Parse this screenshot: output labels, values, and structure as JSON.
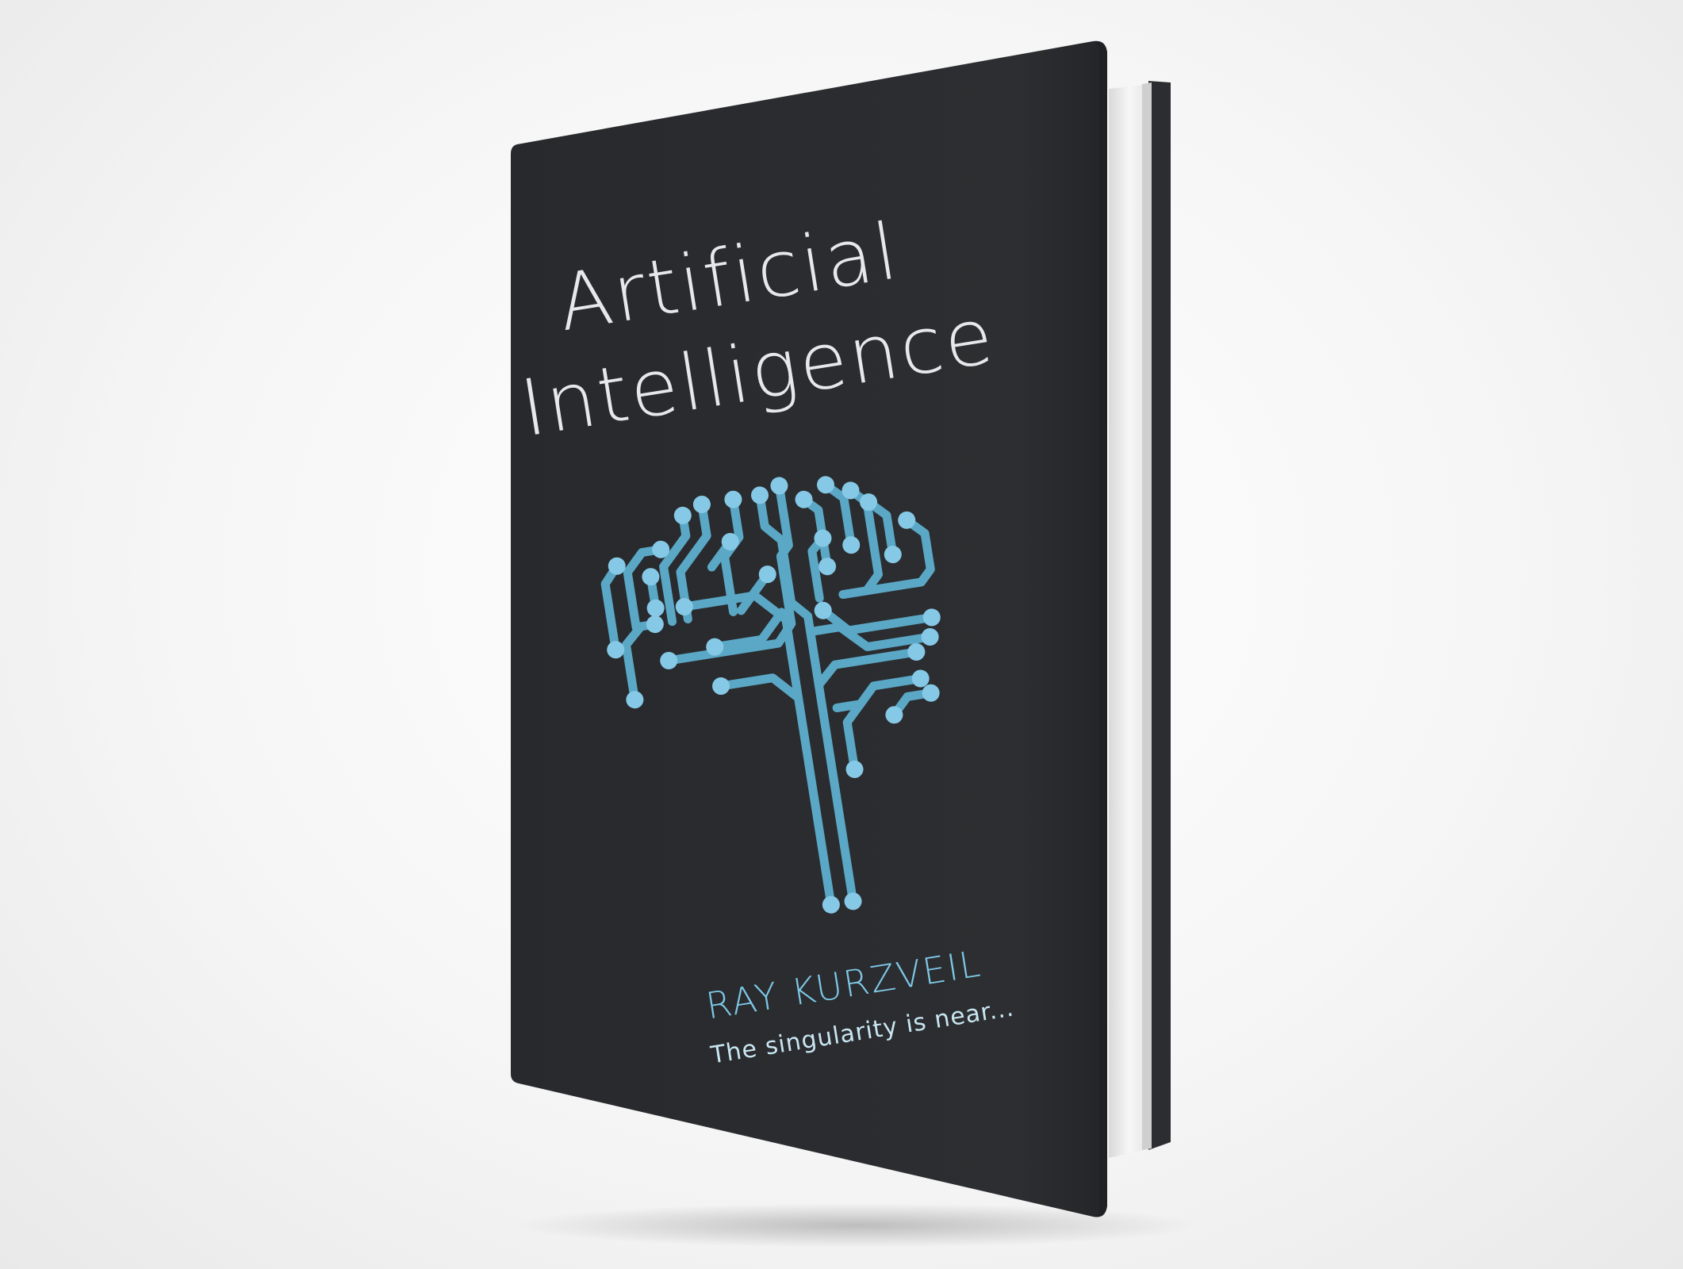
{
  "book": {
    "title_line1": "Artificial",
    "title_line2": "Intelligence",
    "author": "RAY KURZVEIL",
    "tagline": "The singularity is near..."
  },
  "colors": {
    "background": "#f4f4f4",
    "cover": "#2a2c2f",
    "title_text": "#e6e8ec",
    "author_text": "#7ec8e6",
    "tagline_text": "#c9e6f2",
    "circuit_line": "#5ba8c6",
    "circuit_node": "#86c9e6",
    "pages": "#f2f2f2"
  },
  "icons": {
    "illustration": "circuit-brain-icon"
  }
}
